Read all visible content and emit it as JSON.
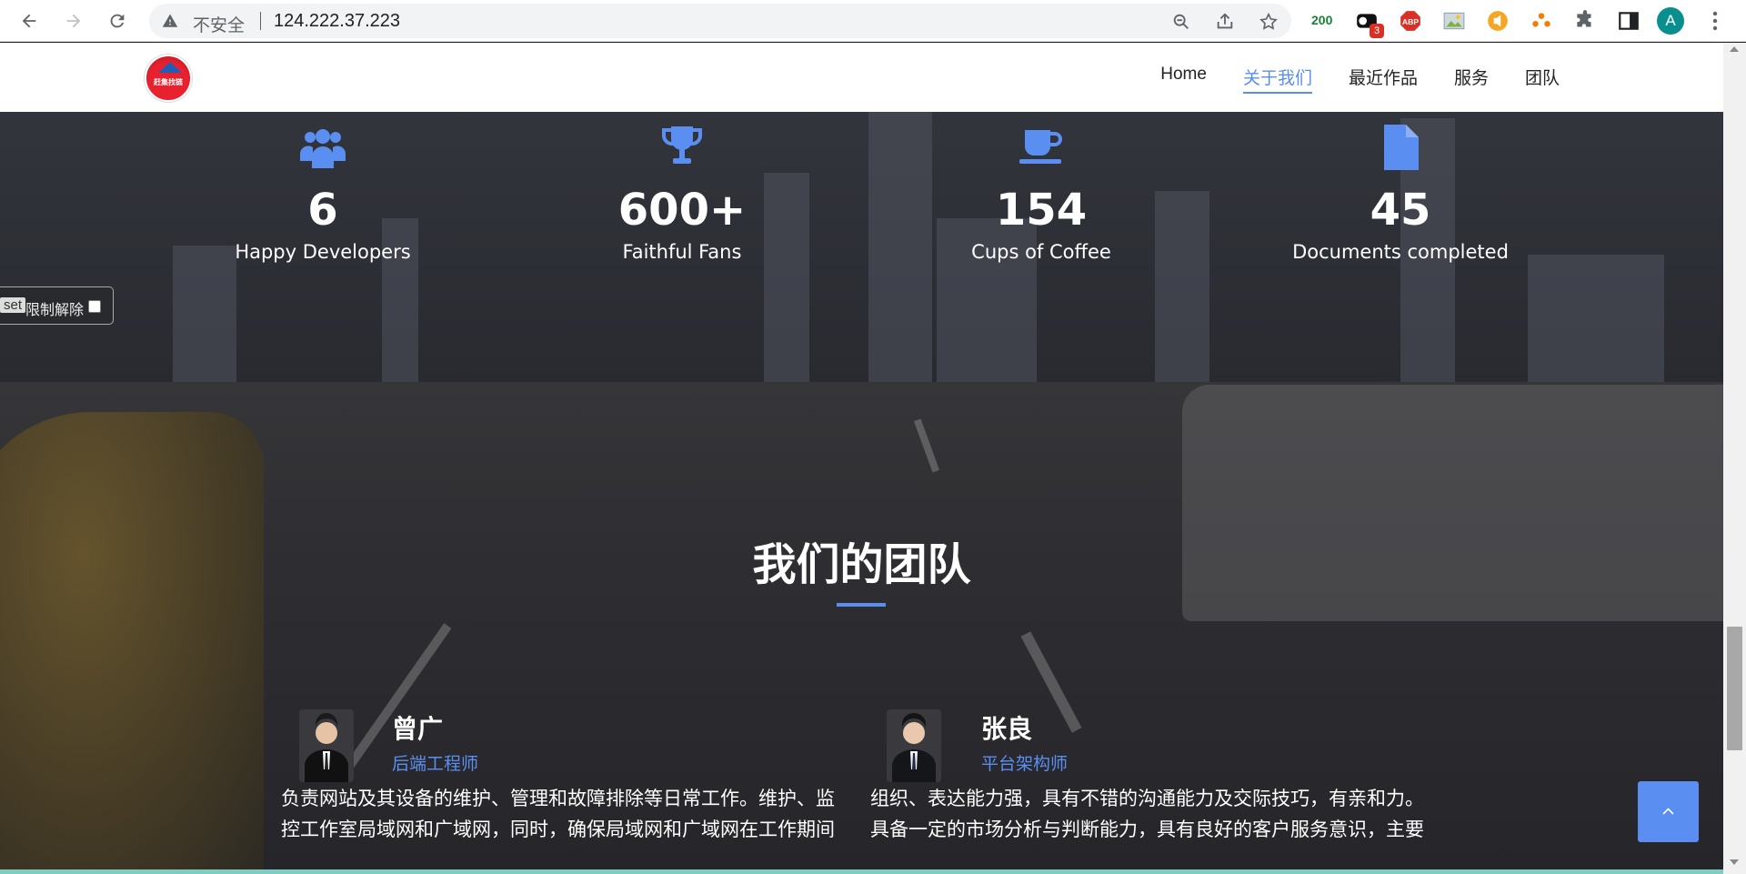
{
  "browser": {
    "insecure_label": "不安全",
    "url": "124.222.37.223",
    "ext_counter": "200",
    "ext_badge": "3",
    "ext_abp": "ABP",
    "avatar_initial": "A"
  },
  "site": {
    "nav": {
      "home": "Home",
      "about": "关于我们",
      "works": "最近作品",
      "services": "服务",
      "team": "团队"
    },
    "logo_text": "赶集找链",
    "colors": {
      "accent": "#5a8ef0",
      "logo_red": "#e8212e"
    }
  },
  "stats": [
    {
      "icon": "users-icon",
      "value": "6",
      "label": "Happy Developers"
    },
    {
      "icon": "trophy-icon",
      "value": "600+",
      "label": "Faithful Fans"
    },
    {
      "icon": "coffee-icon",
      "value": "154",
      "label": "Cups of Coffee"
    },
    {
      "icon": "document-icon",
      "value": "45",
      "label": "Documents completed"
    }
  ],
  "reset_widget": {
    "tag": "set",
    "label": "限制解除"
  },
  "team": {
    "title": "我们的团队",
    "members": [
      {
        "name": "曾广",
        "role": "后端工程师",
        "desc_line1": "负责网站及其设备的维护、管理和故障排除等日常工作。维护、监",
        "desc_line2": "控工作室局域网和广域网，同时，确保局域网和广域网在工作期间"
      },
      {
        "name": "张良",
        "role": "平台架构师",
        "desc_line1": "组织、表达能力强，具有不错的沟通能力及交际技巧，有亲和力。",
        "desc_line2": "具备一定的市场分析与判断能力，具有良好的客户服务意识，主要"
      }
    ]
  }
}
